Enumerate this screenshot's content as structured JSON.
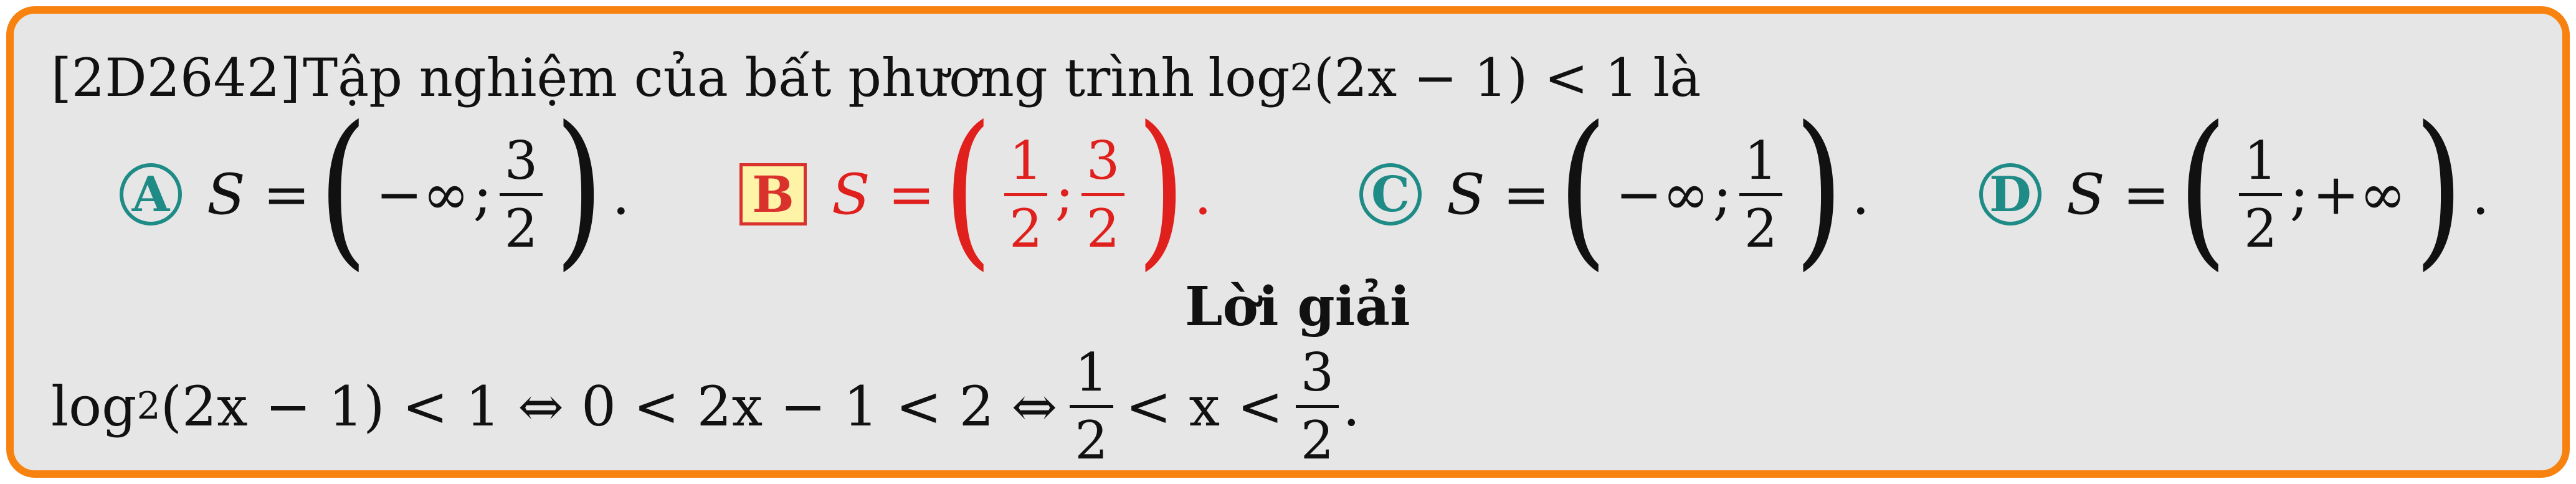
{
  "question": {
    "code": "[2D2642]",
    "text": "Tập nghiệm của bất phương trình",
    "log": "log",
    "log_base": "2",
    "argument": "(2x − 1) < 1",
    "tail": "là"
  },
  "options": [
    {
      "letter": "A",
      "lhs": "S =",
      "lower": "−∞",
      "upper_num": "3",
      "upper_den": "2",
      "correct": false
    },
    {
      "letter": "B",
      "lhs": "S =",
      "lower_num": "1",
      "lower_den": "2",
      "upper_num": "3",
      "upper_den": "2",
      "correct": true
    },
    {
      "letter": "C",
      "lhs": "S =",
      "lower": "−∞",
      "upper_num": "1",
      "upper_den": "2",
      "correct": false
    },
    {
      "letter": "D",
      "lhs": "S =",
      "lower_num": "1",
      "lower_den": "2",
      "upper": "+∞",
      "correct": false
    }
  ],
  "solution_title": "Lời giải",
  "solution": {
    "log": "log",
    "log_base": "2",
    "chain": "(2x − 1) < 1 ⇔ 0 < 2x − 1 < 2 ⇔",
    "frac1_num": "1",
    "frac1_den": "2",
    "mid": "< x <",
    "frac2_num": "3",
    "frac2_den": "2",
    "end": "."
  },
  "colors": {
    "frame": "#f7820f",
    "background": "#e6e6e6",
    "option_circle": "#1f8b86",
    "correct": "#e0201c",
    "correct_box_fill": "#fff3a8"
  }
}
